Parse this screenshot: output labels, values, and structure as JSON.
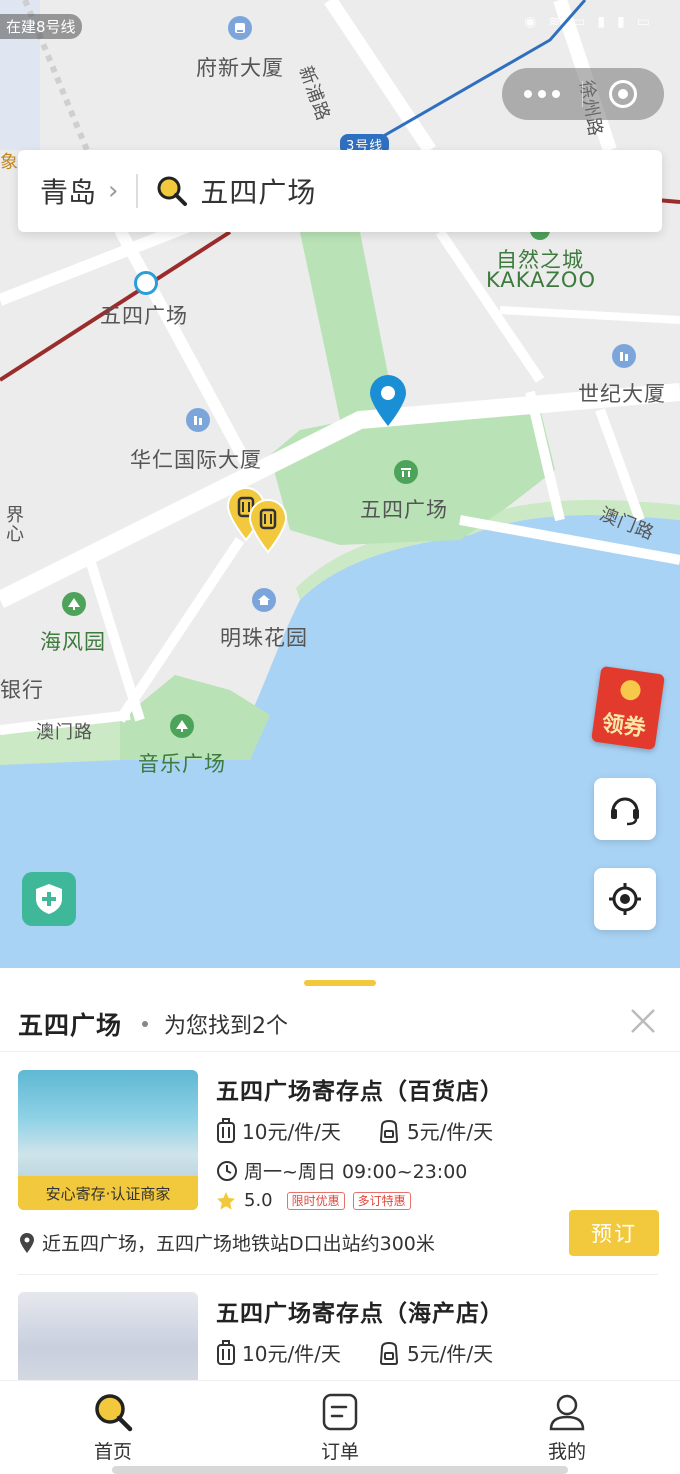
{
  "status_bar": {
    "carrier": "在建8号线"
  },
  "capsule": {
    "more_icon": "more-dots-icon",
    "close_icon": "close-circle-icon"
  },
  "search": {
    "city": "青岛",
    "query": "五四广场"
  },
  "map": {
    "labels": {
      "fuxin": "府新大厦",
      "xinpu": "新浦路",
      "xuzhou": "徐州路",
      "line3": "3号线",
      "metro_54": "五四广场",
      "nature": "自然之城",
      "kakazoo": "KAKAZOO",
      "century": "世纪大厦",
      "huaren": "华仁国际大厦",
      "park_54": "五四广场",
      "aomen1": "澳门路",
      "haifeng": "海风园",
      "mingzhu": "明珠花园",
      "bank": "银行",
      "aomen2": "澳门路",
      "music": "音乐广场",
      "edge_left": "界心",
      "edge_xiang": "象"
    }
  },
  "coupon": {
    "label": "领券"
  },
  "sheet": {
    "title": "五四广场",
    "count_text": "为您找到2个",
    "stores": [
      {
        "name": "五四广场寄存点（百货店）",
        "badge": "安心寄存·认证商家",
        "price_large": "10元/件/天",
        "price_small": "5元/件/天",
        "hours": "周一~周日 09:00~23:00",
        "rating": "5.0",
        "tags": [
          "限时优惠",
          "多订特惠"
        ],
        "address": "近五四广场，五四广场地铁站D口出站约300米",
        "book_label": "预订"
      },
      {
        "name": "五四广场寄存点（海产店）",
        "price_large": "10元/件/天",
        "price_small": "5元/件/天"
      }
    ]
  },
  "tabs": [
    {
      "label": "首页",
      "icon": "search-icon",
      "active": true
    },
    {
      "label": "订单",
      "icon": "order-icon",
      "active": false
    },
    {
      "label": "我的",
      "icon": "user-icon",
      "active": false
    }
  ],
  "colors": {
    "accent": "#f2c93c",
    "water": "#a9d3f5",
    "park": "#b9e3b6",
    "marker_blue": "#1a8fd6"
  }
}
